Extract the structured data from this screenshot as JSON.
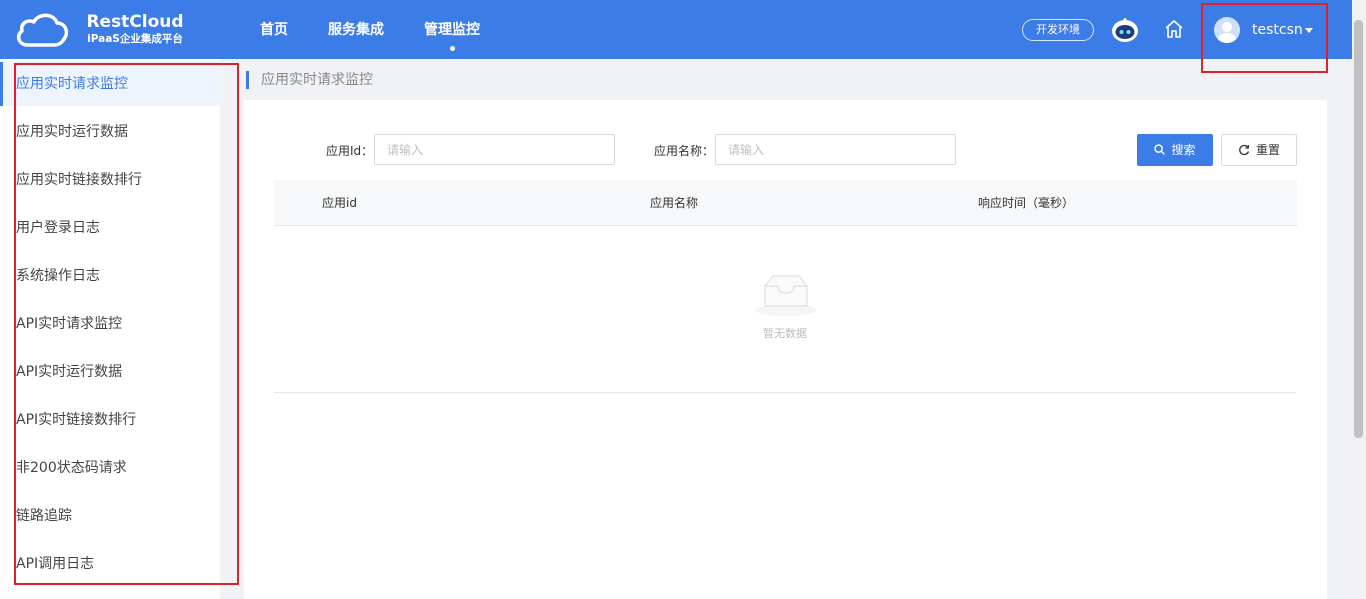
{
  "brand": {
    "name": "RestCloud",
    "subtitle": "iPaaS企业集成平台"
  },
  "nav": [
    {
      "label": "首页"
    },
    {
      "label": "服务集成"
    },
    {
      "label": "管理监控"
    }
  ],
  "header": {
    "env_label": "开发环境",
    "username": "testcsn"
  },
  "sidebar": {
    "items": [
      {
        "label": "应用实时请求监控"
      },
      {
        "label": "应用实时运行数据"
      },
      {
        "label": "应用实时链接数排行"
      },
      {
        "label": "用户登录日志"
      },
      {
        "label": "系统操作日志"
      },
      {
        "label": "API实时请求监控"
      },
      {
        "label": "API实时运行数据"
      },
      {
        "label": "API实时链接数排行"
      },
      {
        "label": "非200状态码请求"
      },
      {
        "label": "链路追踪"
      },
      {
        "label": "API调用日志"
      }
    ]
  },
  "breadcrumb": "应用实时请求监控",
  "filters": {
    "app_id_label": "应用Id：",
    "app_id_placeholder": "请输入",
    "app_name_label": "应用名称：",
    "app_name_placeholder": "请输入",
    "search_label": "搜索",
    "reset_label": "重置"
  },
  "table": {
    "columns": [
      "应用id",
      "应用名称",
      "响应时间（毫秒）"
    ],
    "empty_text": "暂无数据"
  },
  "colors": {
    "primary": "#3b7ce7",
    "highlight": "#e0202c"
  }
}
